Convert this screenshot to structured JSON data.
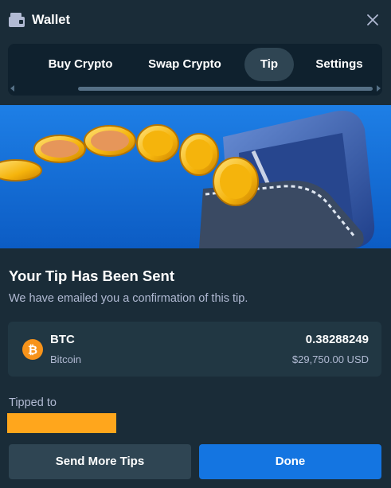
{
  "header": {
    "title": "Wallet",
    "icon": "wallet-icon",
    "close_icon": "close-icon"
  },
  "tabs": [
    {
      "label": "Buy Crypto",
      "active": false
    },
    {
      "label": "Swap Crypto",
      "active": false
    },
    {
      "label": "Tip",
      "active": true
    },
    {
      "label": "Settings",
      "active": false
    }
  ],
  "confirmation": {
    "heading": "Your Tip Has Been Sent",
    "subtext": "We have emailed you a confirmation of this tip."
  },
  "coin": {
    "symbol": "BTC",
    "name": "Bitcoin",
    "amount": "0.38288249",
    "usd_value": "$29,750.00 USD",
    "icon": "bitcoin-icon"
  },
  "recipient": {
    "label": "Tipped to"
  },
  "actions": {
    "send_more_label": "Send More Tips",
    "done_label": "Done"
  },
  "colors": {
    "background": "#1a2c38",
    "panel": "#213743",
    "tab_bar": "#0f212e",
    "active_tab": "#2f4553",
    "primary": "#1475e1",
    "muted_text": "#b1bad3",
    "bitcoin": "#f7931a",
    "redaction": "#ffa61c"
  }
}
